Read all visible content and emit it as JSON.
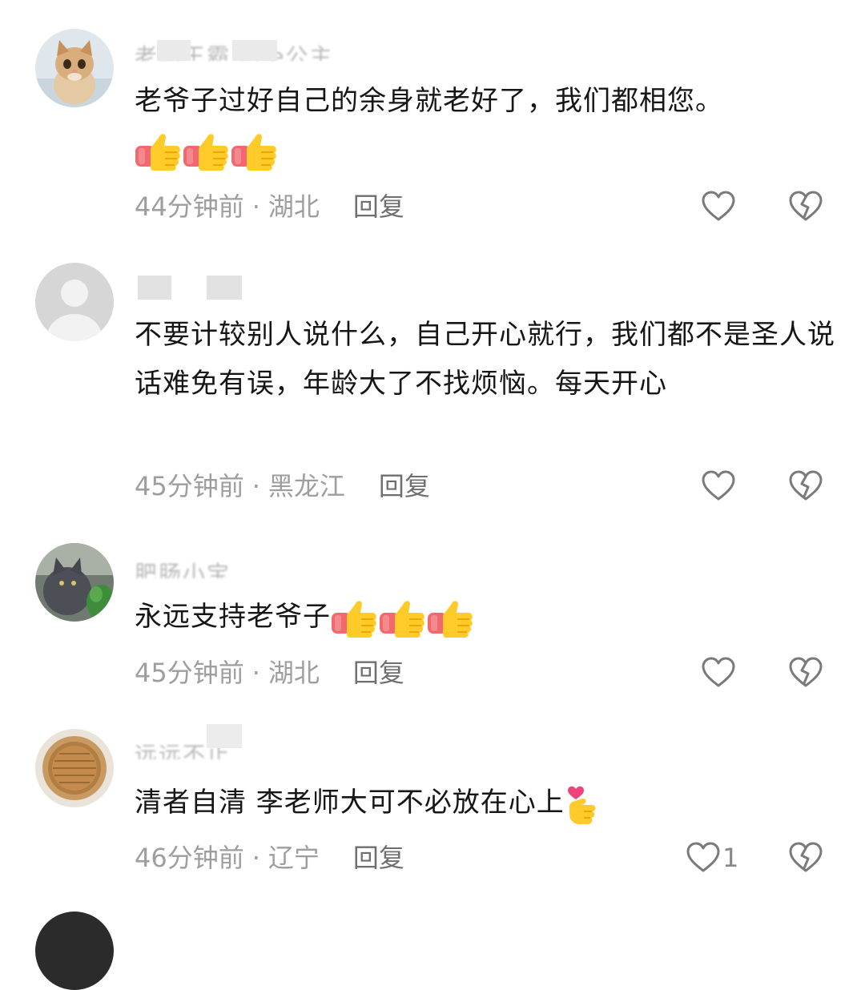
{
  "comments": [
    {
      "username": "老霸王霸王ee公主",
      "text": "老爷子过好自己的余身就老好了，我们都相您。",
      "emoji": "thumbs-up",
      "emoji_count": 3,
      "time": "44分钟前",
      "location": "湖北",
      "reply_label": "回复",
      "likes": ""
    },
    {
      "username": "",
      "text": "不要计较别人说什么，自己开心就行，我们都不是圣人说话难免有误，年龄大了不找烦恼。每天开心",
      "emoji": "",
      "emoji_count": 0,
      "time": "45分钟前",
      "location": "黑龙江",
      "reply_label": "回复",
      "likes": ""
    },
    {
      "username": "肥肠小宝",
      "text": "永远支持老爷子",
      "emoji": "thumbs-up",
      "emoji_count": 3,
      "time": "45分钟前",
      "location": "湖北",
      "reply_label": "回复",
      "likes": ""
    },
    {
      "username": "远远不止",
      "text": "清者自清 李老师大可不必放在心上",
      "emoji": "finger-heart",
      "emoji_count": 1,
      "time": "46分钟前",
      "location": "辽宁",
      "reply_label": "回复",
      "likes": "1"
    }
  ],
  "icons": {
    "like": "heart-outline-icon",
    "dislike": "broken-heart-icon"
  },
  "colors": {
    "meta_text": "#9e9e9e",
    "body_text": "#161616",
    "icon_stroke": "#777777"
  }
}
